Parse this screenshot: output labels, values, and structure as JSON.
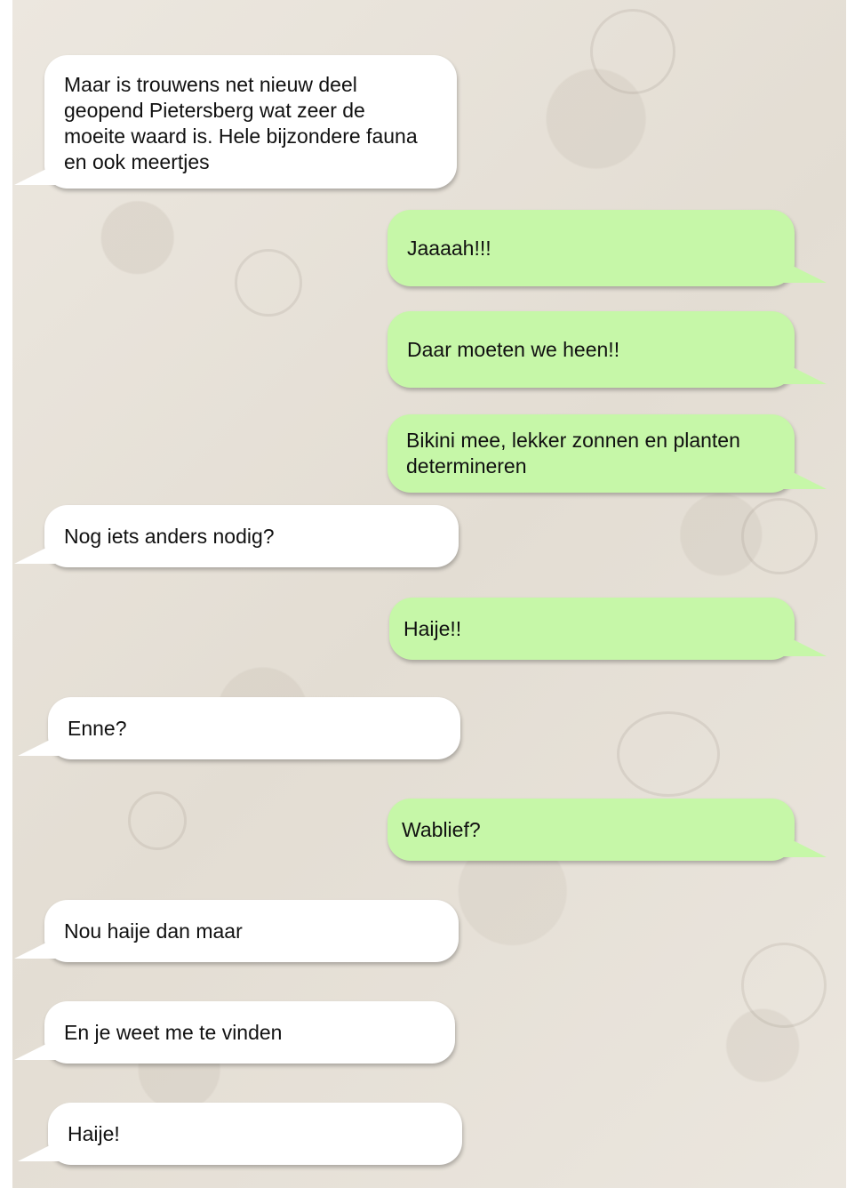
{
  "messages": [
    {
      "from": "them",
      "lines": [
        "Maar is trouwens net nieuw deel",
        "geopend Pietersberg wat zeer de",
        "moeite waard is. Hele bijzondere fauna",
        " en ook meertjes"
      ]
    },
    {
      "from": "me",
      "lines": [
        "Jaaaah!!!"
      ]
    },
    {
      "from": "me",
      "lines": [
        "Daar moeten we heen!!"
      ]
    },
    {
      "from": "me",
      "lines": [
        "Bikini mee, lekker zonnen en planten",
        "determineren"
      ]
    },
    {
      "from": "them",
      "lines": [
        "Nog iets anders nodig?"
      ]
    },
    {
      "from": "me",
      "lines": [
        "Haije!!"
      ]
    },
    {
      "from": "them",
      "lines": [
        "Enne?"
      ]
    },
    {
      "from": "me",
      "lines": [
        "Wablief?"
      ]
    },
    {
      "from": "them",
      "lines": [
        "Nou haije dan maar"
      ]
    },
    {
      "from": "them",
      "lines": [
        "En je weet me te vinden"
      ]
    },
    {
      "from": "them",
      "lines": [
        "Haije!"
      ]
    }
  ],
  "colors": {
    "incoming_bubble": "#ffffff",
    "outgoing_bubble": "#c6f7a8",
    "background": "#e9e4dc"
  }
}
